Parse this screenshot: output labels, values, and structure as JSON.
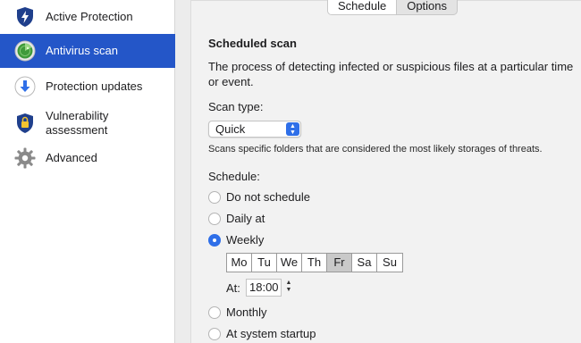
{
  "sidebar": {
    "items": [
      {
        "label": "Active Protection",
        "icon": "shield-bolt-icon"
      },
      {
        "label": "Antivirus scan",
        "icon": "radar-icon"
      },
      {
        "label": "Protection updates",
        "icon": "download-arrow-icon"
      },
      {
        "label": "Vulnerability assessment",
        "icon": "shield-lock-icon"
      },
      {
        "label": "Advanced",
        "icon": "gear-icon"
      }
    ],
    "active_index": 1
  },
  "tabs": [
    {
      "label": "Schedule",
      "selected": true
    },
    {
      "label": "Options",
      "selected": false
    }
  ],
  "main": {
    "title": "Scheduled scan",
    "description": "The process of detecting infected or suspicious files at a particular time or event.",
    "scan_type_label": "Scan type:",
    "scan_type_value": "Quick",
    "scan_type_hint": "Scans specific folders that are considered the most likely storages of threats.",
    "schedule_label": "Schedule:",
    "options": [
      {
        "label": "Do not schedule",
        "checked": false
      },
      {
        "label": "Daily at",
        "checked": false
      },
      {
        "label": "Weekly",
        "checked": true
      },
      {
        "label": "Monthly",
        "checked": false
      },
      {
        "label": "At system startup",
        "checked": false
      }
    ],
    "days": [
      "Mo",
      "Tu",
      "We",
      "Th",
      "Fr",
      "Sa",
      "Su"
    ],
    "selected_day": "Fr",
    "at_label": "At:",
    "time_value": "18:00"
  },
  "colors": {
    "accent": "#2456c8",
    "radio_accent": "#2f6fe8",
    "shield": "#1f3f8c"
  }
}
